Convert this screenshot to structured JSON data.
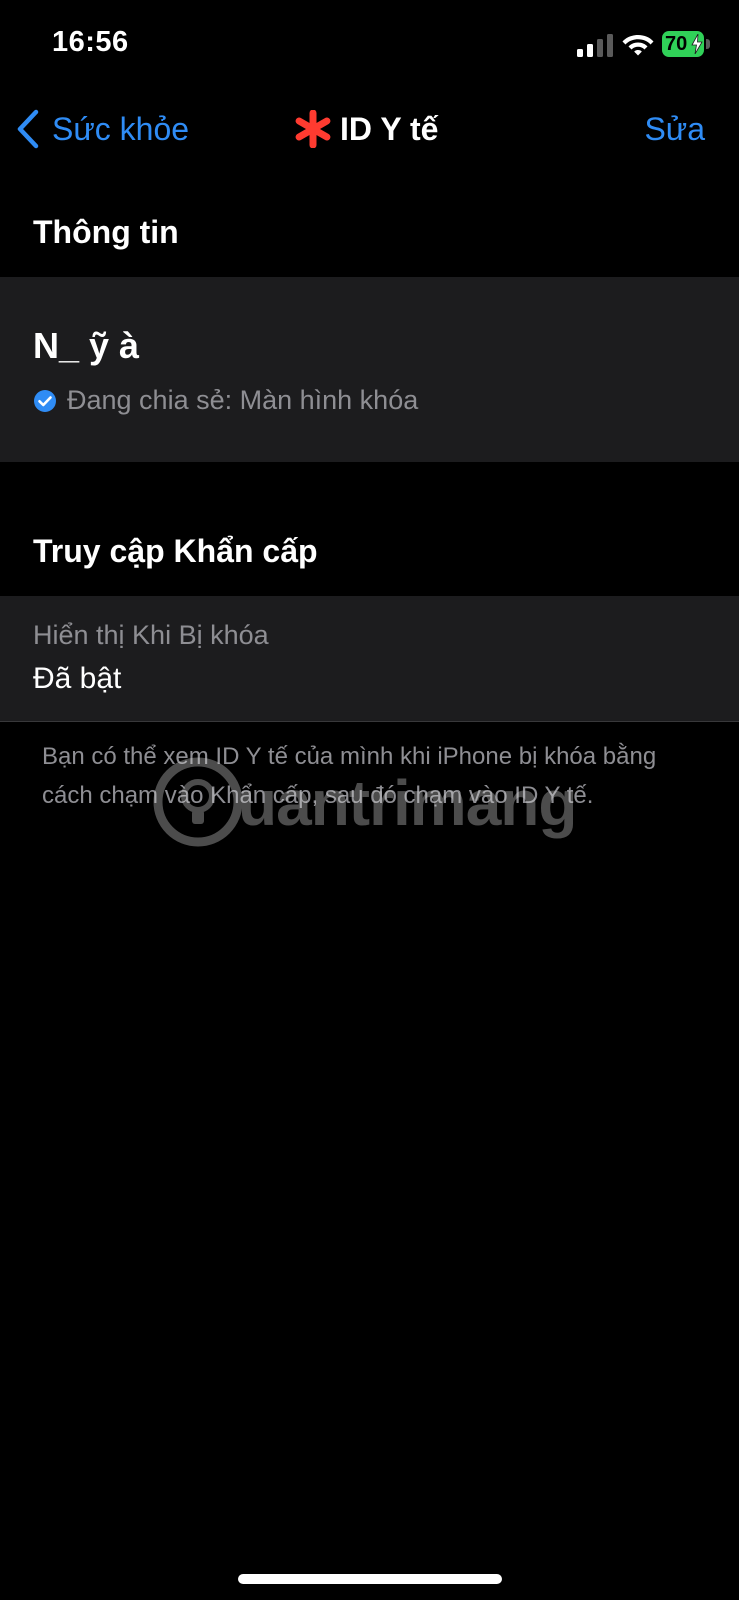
{
  "status_bar": {
    "time": "16:56",
    "battery_level": "70",
    "battery_charging": true,
    "signal_icon": "cellular-signal-icon",
    "wifi_icon": "wifi-icon"
  },
  "nav": {
    "back_label": "Sức khỏe",
    "title": "ID Y tế",
    "edit_label": "Sửa",
    "title_icon": "medical-asterisk-icon"
  },
  "info_section": {
    "header": "Thông tin",
    "name": "N_  ỹ        à",
    "share_status": "Đang chia sẻ: Màn hình khóa"
  },
  "emergency_section": {
    "header": "Truy cập Khẩn cấp",
    "lock_label": "Hiển thị Khi Bị khóa",
    "lock_value": "Đã bật",
    "footer": "Bạn có thể xem ID Y tế của mình khi iPhone bị khóa bằng cách chạm vào Khẩn cấp, sau đó chạm vào ID Y tế."
  },
  "watermark": {
    "text": "uantrimang"
  },
  "colors": {
    "background": "#000000",
    "card": "#1c1c1e",
    "accent": "#2f8cf5",
    "asterisk": "#ff3b30",
    "battery": "#30d158",
    "secondary_text": "#8e8e93"
  }
}
